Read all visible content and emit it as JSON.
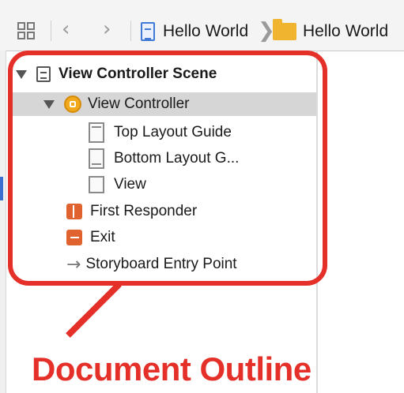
{
  "toolbar": {
    "grid_icon": "grid-icon",
    "back_glyph": "‹",
    "forward_glyph": "›",
    "breadcrumbs": [
      {
        "label": "Hello World",
        "icon": "file-icon"
      },
      {
        "label": "Hello World",
        "icon": "folder-icon"
      }
    ],
    "crumb_separator": "❯"
  },
  "outline": {
    "scene": {
      "label": "View Controller Scene",
      "icon": "scene-icon",
      "expanded": true
    },
    "view_controller": {
      "label": "View Controller",
      "icon": "view-controller-icon",
      "expanded": true,
      "selected": true
    },
    "children": [
      {
        "label": "Top Layout Guide",
        "icon": "top-layout-guide-icon"
      },
      {
        "label": "Bottom Layout G...",
        "icon": "bottom-layout-guide-icon"
      },
      {
        "label": "View",
        "icon": "view-icon"
      }
    ],
    "first_responder": {
      "label": "First Responder",
      "icon": "first-responder-icon"
    },
    "exit": {
      "label": "Exit",
      "icon": "exit-icon"
    },
    "entry_point": {
      "label": "Storyboard Entry Point",
      "icon": "arrow-icon",
      "glyph": "→"
    }
  },
  "annotation": {
    "caption": "Document Outline",
    "color": "#e5302a"
  },
  "colors": {
    "selection": "#d6d6d6",
    "accent_orange": "#f0a91a",
    "folder": "#f1b42f"
  }
}
